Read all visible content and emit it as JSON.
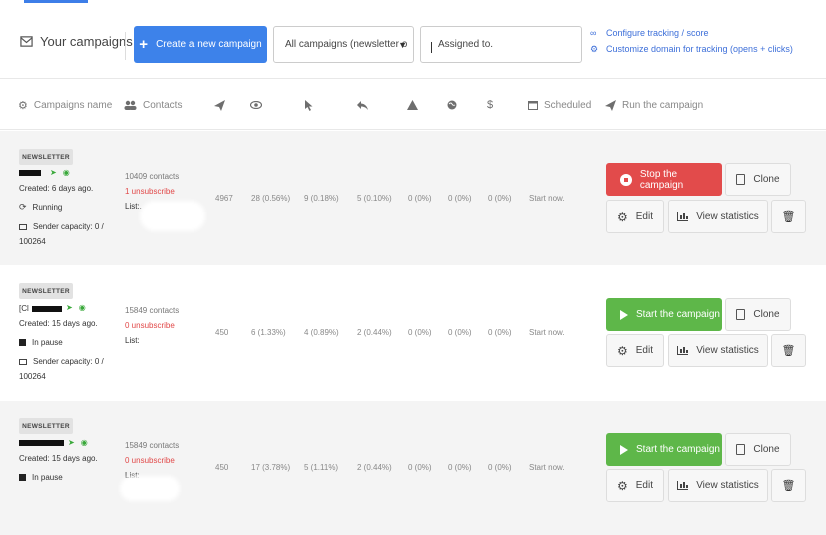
{
  "header": {
    "title": "Your campaigns",
    "create_button": "Create a new campaign",
    "filter_select": "All campaigns (newsletter o",
    "assigned_placeholder": "Assigned to.",
    "link_tracking": "Configure tracking / score",
    "link_domain": "Customize domain for tracking (opens + clicks)"
  },
  "columns": {
    "name": "Campaigns name",
    "contacts": "Contacts",
    "scheduled": "Scheduled",
    "run": "Run the campaign",
    "dollar": "$"
  },
  "icons": [
    "envelope-icon",
    "plus-icon",
    "chevron-down-icon",
    "link-icon",
    "gear-icon",
    "users-icon",
    "paper-plane-icon",
    "eye-icon",
    "pointer-icon",
    "reply-icon",
    "warning-icon",
    "globe-icon",
    "dollar-icon",
    "calendar-icon",
    "stop-icon",
    "play-icon",
    "clone-icon",
    "bar-chart-icon",
    "trash-icon"
  ],
  "colors": {
    "primary": "#3d82ea",
    "stop": "#e24b4b",
    "start": "#5eb749",
    "link": "#3d6fd9",
    "unsub": "#e14848"
  },
  "campaigns": [
    {
      "badge": "NEWSLETTER",
      "name_prefix": "",
      "created": "Created: 6 days ago.",
      "status": "Running",
      "capacity_1": "Sender capacity: 0 /",
      "capacity_2": "100264",
      "contacts": "10409 contacts",
      "unsubscribe": "1 unsubscribe",
      "list": "List:.",
      "sent": "4967",
      "opens": "28 (0.56%)",
      "clicks": "9 (0.18%)",
      "replies": "5 (0.10%)",
      "bounces": "0 (0%)",
      "unsub_pct": "0 (0%)",
      "revenue": "0 (0%)",
      "scheduled": "Start now.",
      "action": "Stop the campaign",
      "clone": "Clone",
      "edit": "Edit",
      "stats": "View statistics"
    },
    {
      "badge": "NEWSLETTER",
      "name_prefix": "[Cl",
      "created": "Created: 15 days ago.",
      "status": "In pause",
      "capacity_1": "Sender capacity: 0 /",
      "capacity_2": "100264",
      "contacts": "15849 contacts",
      "unsubscribe": "0 unsubscribe",
      "list": "List:",
      "sent": "450",
      "opens": "6 (1.33%)",
      "clicks": "4 (0.89%)",
      "replies": "2 (0.44%)",
      "bounces": "0 (0%)",
      "unsub_pct": "0 (0%)",
      "revenue": "0 (0%)",
      "scheduled": "Start now.",
      "action": "Start the campaign",
      "clone": "Clone",
      "edit": "Edit",
      "stats": "View statistics"
    },
    {
      "badge": "NEWSLETTER",
      "name_prefix": "",
      "created": "Created: 15 days ago.",
      "status": "In pause",
      "contacts": "15849 contacts",
      "unsubscribe": "0 unsubscribe",
      "list": "List:",
      "sent": "450",
      "opens": "17 (3.78%)",
      "clicks": "5 (1.11%)",
      "replies": "2 (0.44%)",
      "bounces": "0 (0%)",
      "unsub_pct": "0 (0%)",
      "revenue": "0 (0%)",
      "scheduled": "Start now.",
      "action": "Start the campaign",
      "clone": "Clone",
      "edit": "Edit",
      "stats": "View statistics"
    }
  ]
}
